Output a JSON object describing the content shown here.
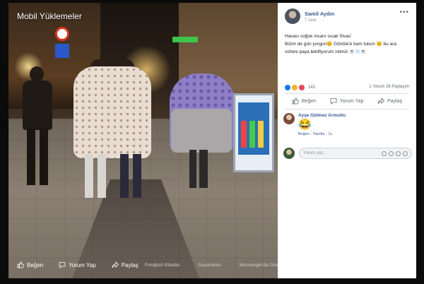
{
  "photo": {
    "album_title": "Mobil Yüklemeler",
    "actions": [
      {
        "label": "Beğen",
        "icon": "thumbs-up-icon"
      },
      {
        "label": "Yorum Yap",
        "icon": "comment-icon"
      },
      {
        "label": "Paylaş",
        "icon": "share-icon"
      }
    ],
    "links": [
      "Fotoğrafı Etiketle",
      "Seçenekler",
      "Messenger'da Gönder"
    ]
  },
  "post": {
    "author": "Samil Aydın",
    "time": "7 saat",
    "more_icon": "ellipsis-icon",
    "text_lines": [
      "Havası soğuk insanı sıcak Sivas'",
      "Bizim de gün yorgun😊 Gördük'e bam tutum 😊 bu ara",
      "sizlere paya teklifiyorum istimiz ☕️❄️☕️"
    ],
    "reactions": {
      "count": "143",
      "types": [
        "like",
        "haha",
        "love"
      ]
    },
    "stats": "1 Yorum  26 Paylaşım",
    "actions": [
      {
        "label": "Beğen",
        "icon": "thumbs-up-icon"
      },
      {
        "label": "Yorum Yap",
        "icon": "comment-icon"
      },
      {
        "label": "Paylaş",
        "icon": "share-icon"
      }
    ]
  },
  "comment": {
    "author": "Ayşe Gülmez Armutlu",
    "emoji": "😂",
    "like_label": "Beğen",
    "reply_label": "Yanıtla",
    "time": "1s"
  },
  "composer": {
    "placeholder": "Yorum yaz..."
  },
  "colors": {
    "link": "#3b5998",
    "panel_bg": "#ffffff",
    "like": "#1877f2",
    "haha": "#f7b125",
    "love": "#e9445a"
  }
}
